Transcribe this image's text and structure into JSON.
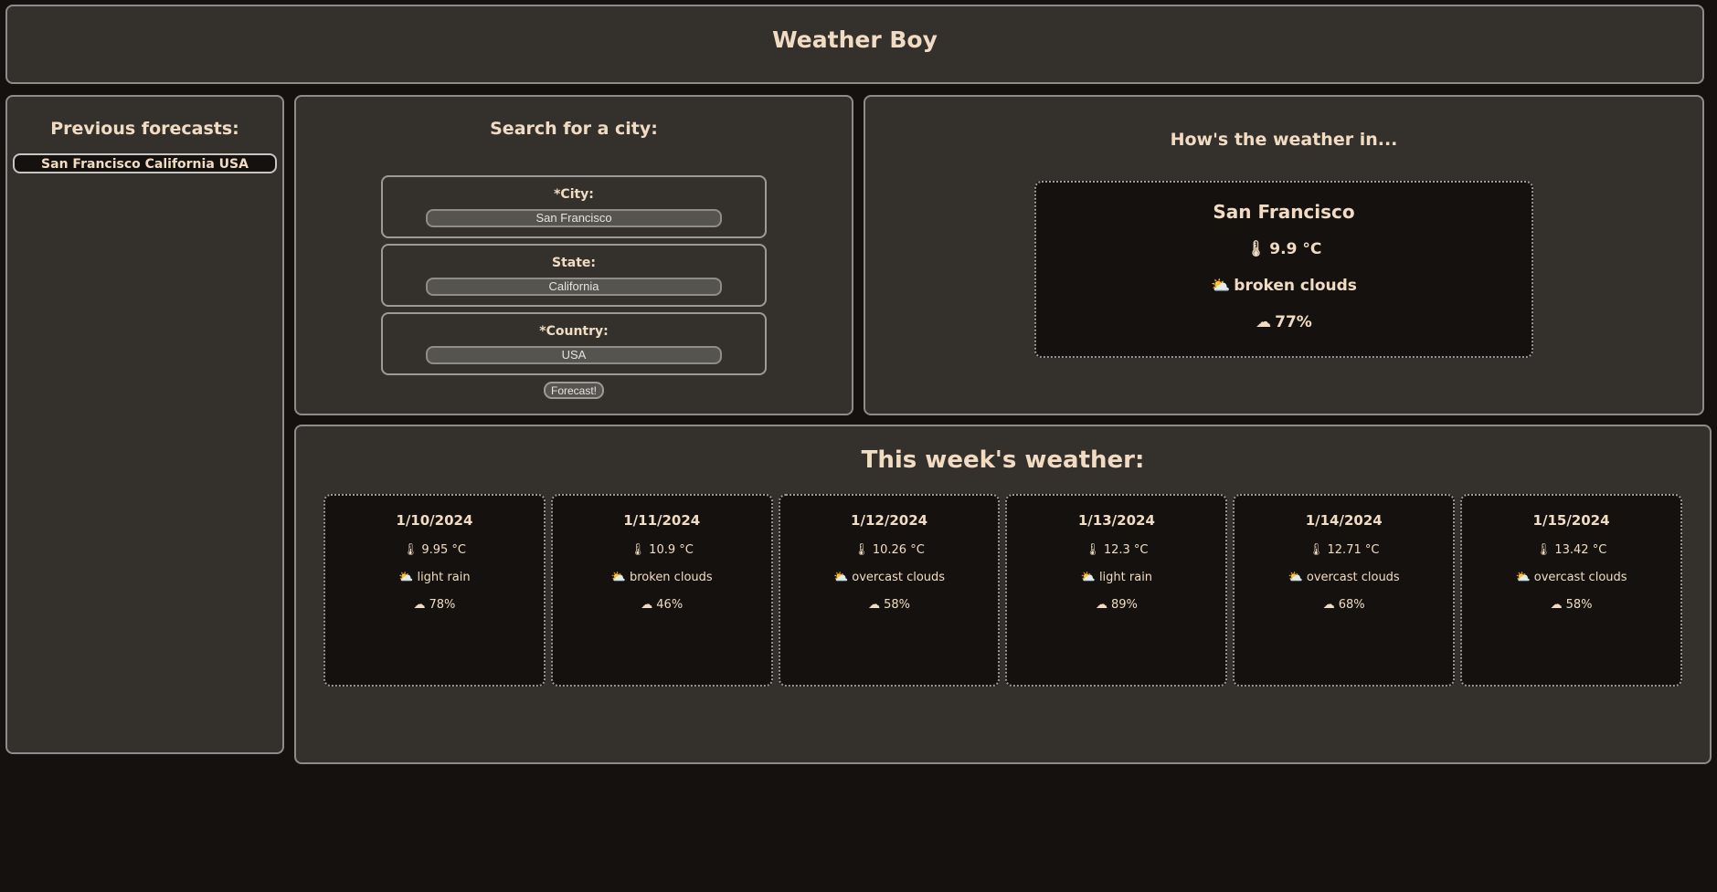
{
  "app": {
    "title": "Weather Boy"
  },
  "history": {
    "heading": "Previous forecasts:",
    "items": [
      "San Francisco California USA"
    ]
  },
  "search": {
    "heading": "Search for a city:",
    "city_label": "*City:",
    "city_value": "San Francisco",
    "state_label": "State:",
    "state_value": "California",
    "country_label": "*Country:",
    "country_value": "USA",
    "button_label": "Forecast!"
  },
  "current": {
    "heading": "How's the weather in...",
    "city": "San Francisco",
    "temp": "9.9 °C",
    "description": "broken clouds",
    "humidity": "77%"
  },
  "week": {
    "heading": "This week's weather:",
    "days": [
      {
        "date": "1/10/2024",
        "temp": "9.95 °C",
        "description": "light rain",
        "humidity": "78%"
      },
      {
        "date": "1/11/2024",
        "temp": "10.9 °C",
        "description": "broken clouds",
        "humidity": "46%"
      },
      {
        "date": "1/12/2024",
        "temp": "10.26 °C",
        "description": "overcast clouds",
        "humidity": "58%"
      },
      {
        "date": "1/13/2024",
        "temp": "12.3 °C",
        "description": "light rain",
        "humidity": "89%"
      },
      {
        "date": "1/14/2024",
        "temp": "12.71 °C",
        "description": "overcast clouds",
        "humidity": "68%"
      },
      {
        "date": "1/15/2024",
        "temp": "13.42 °C",
        "description": "overcast clouds",
        "humidity": "58%"
      }
    ]
  },
  "icons": {
    "thermometer": "thermometer-icon",
    "cloud_sun": "cloud-sun-icon",
    "droplet": "cloud-icon"
  }
}
